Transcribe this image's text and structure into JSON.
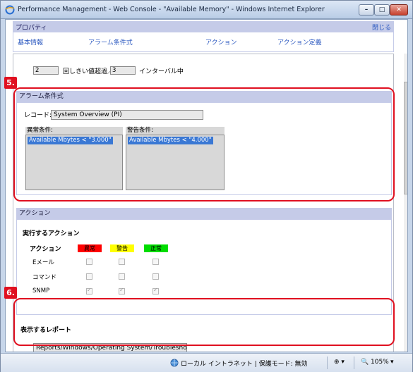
{
  "window": {
    "title": "Performance Management - Web Console - \"Available Memory\" - Windows Internet Explorer",
    "min": "–",
    "max": "□",
    "close": "✕"
  },
  "properties": {
    "label": "プロパティ",
    "close": "閉じる",
    "tabs": [
      "基本情報",
      "アラーム条件式",
      "アクション",
      "アクション定義"
    ]
  },
  "threshold": {
    "value1": "2",
    "text1": "回しきい値超過／",
    "value2": "3",
    "text2": "インターバル中"
  },
  "alarm": {
    "section_title": "アラーム条件式",
    "record_label": "レコード:",
    "record_value": "System Overview (PI)",
    "abnormal_label": "異常条件:",
    "abnormal_item": "Available Mbytes < \"3.000\"",
    "warning_label": "警告条件:",
    "warning_item": "Available Mbytes < \"4.000\""
  },
  "action": {
    "section_title": "アクション",
    "subtitle": "実行するアクション",
    "column_action": "アクション",
    "statuses": [
      "異常",
      "警告",
      "正常"
    ],
    "status_colors": [
      "#ff0000",
      "#ffff00",
      "#00dd00"
    ],
    "rows": [
      {
        "label": "Eメール",
        "checks": [
          false,
          false,
          false
        ]
      },
      {
        "label": "コマンド",
        "checks": [
          false,
          false,
          false
        ]
      },
      {
        "label": "SNMP",
        "checks": [
          true,
          true,
          true
        ]
      }
    ]
  },
  "report": {
    "title": "表示するレポート",
    "value": "Reports/Windows/Operating System/Troublesho"
  },
  "callouts": [
    "5.",
    "6."
  ],
  "statusbar": {
    "zone": "ローカル イントラネット | 保護モード: 無効",
    "zoom": "105%"
  }
}
